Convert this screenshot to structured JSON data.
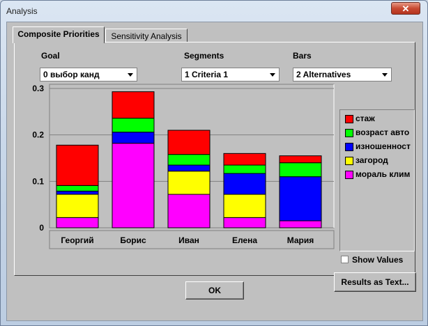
{
  "window": {
    "title": "Analysis",
    "close_glyph": "✕"
  },
  "tabs": [
    {
      "label": "Composite Priorities",
      "active": true
    },
    {
      "label": "Sensitivity Analysis",
      "active": false
    }
  ],
  "controls": {
    "goal_label": "Goal",
    "goal_value": "0 выбор канд",
    "segments_label": "Segments",
    "segments_value": "1 Criteria 1",
    "bars_label": "Bars",
    "bars_value": "2 Alternatives"
  },
  "legend": [
    {
      "label": "стаж",
      "color": "#ff0000"
    },
    {
      "label": "возраст авто",
      "color": "#00ff00"
    },
    {
      "label": "изношенност",
      "color": "#0000ff"
    },
    {
      "label": "загород",
      "color": "#ffff00"
    },
    {
      "label": "мораль клим",
      "color": "#ff00ff"
    }
  ],
  "show_values": {
    "label": "Show Values",
    "checked": false
  },
  "results_button": "Results as Text...",
  "ok_button": "OK",
  "chart_data": {
    "type": "bar",
    "stacked": true,
    "ylim": [
      0,
      0.3
    ],
    "yticks": [
      {
        "value": 0,
        "label": "0"
      },
      {
        "value": 0.1,
        "label": "0.1"
      },
      {
        "value": 0.2,
        "label": "0.2"
      },
      {
        "value": 0.3,
        "label": "0.3"
      }
    ],
    "grid": true,
    "categories": [
      "Георгий",
      "Борис",
      "Иван",
      "Елена",
      "Мария"
    ],
    "series": [
      {
        "name": "мораль клим",
        "color": "#ff00ff",
        "values": [
          0.022,
          0.182,
          0.072,
          0.022,
          0.015
        ]
      },
      {
        "name": "загород",
        "color": "#ffff00",
        "values": [
          0.05,
          0.0,
          0.05,
          0.05,
          0.0
        ]
      },
      {
        "name": "изношенност",
        "color": "#0000ff",
        "values": [
          0.007,
          0.024,
          0.013,
          0.045,
          0.095
        ]
      },
      {
        "name": "возраст авто",
        "color": "#00ff00",
        "values": [
          0.012,
          0.03,
          0.023,
          0.018,
          0.03
        ]
      },
      {
        "name": "стаж",
        "color": "#ff0000",
        "values": [
          0.087,
          0.057,
          0.052,
          0.025,
          0.015
        ]
      }
    ]
  }
}
